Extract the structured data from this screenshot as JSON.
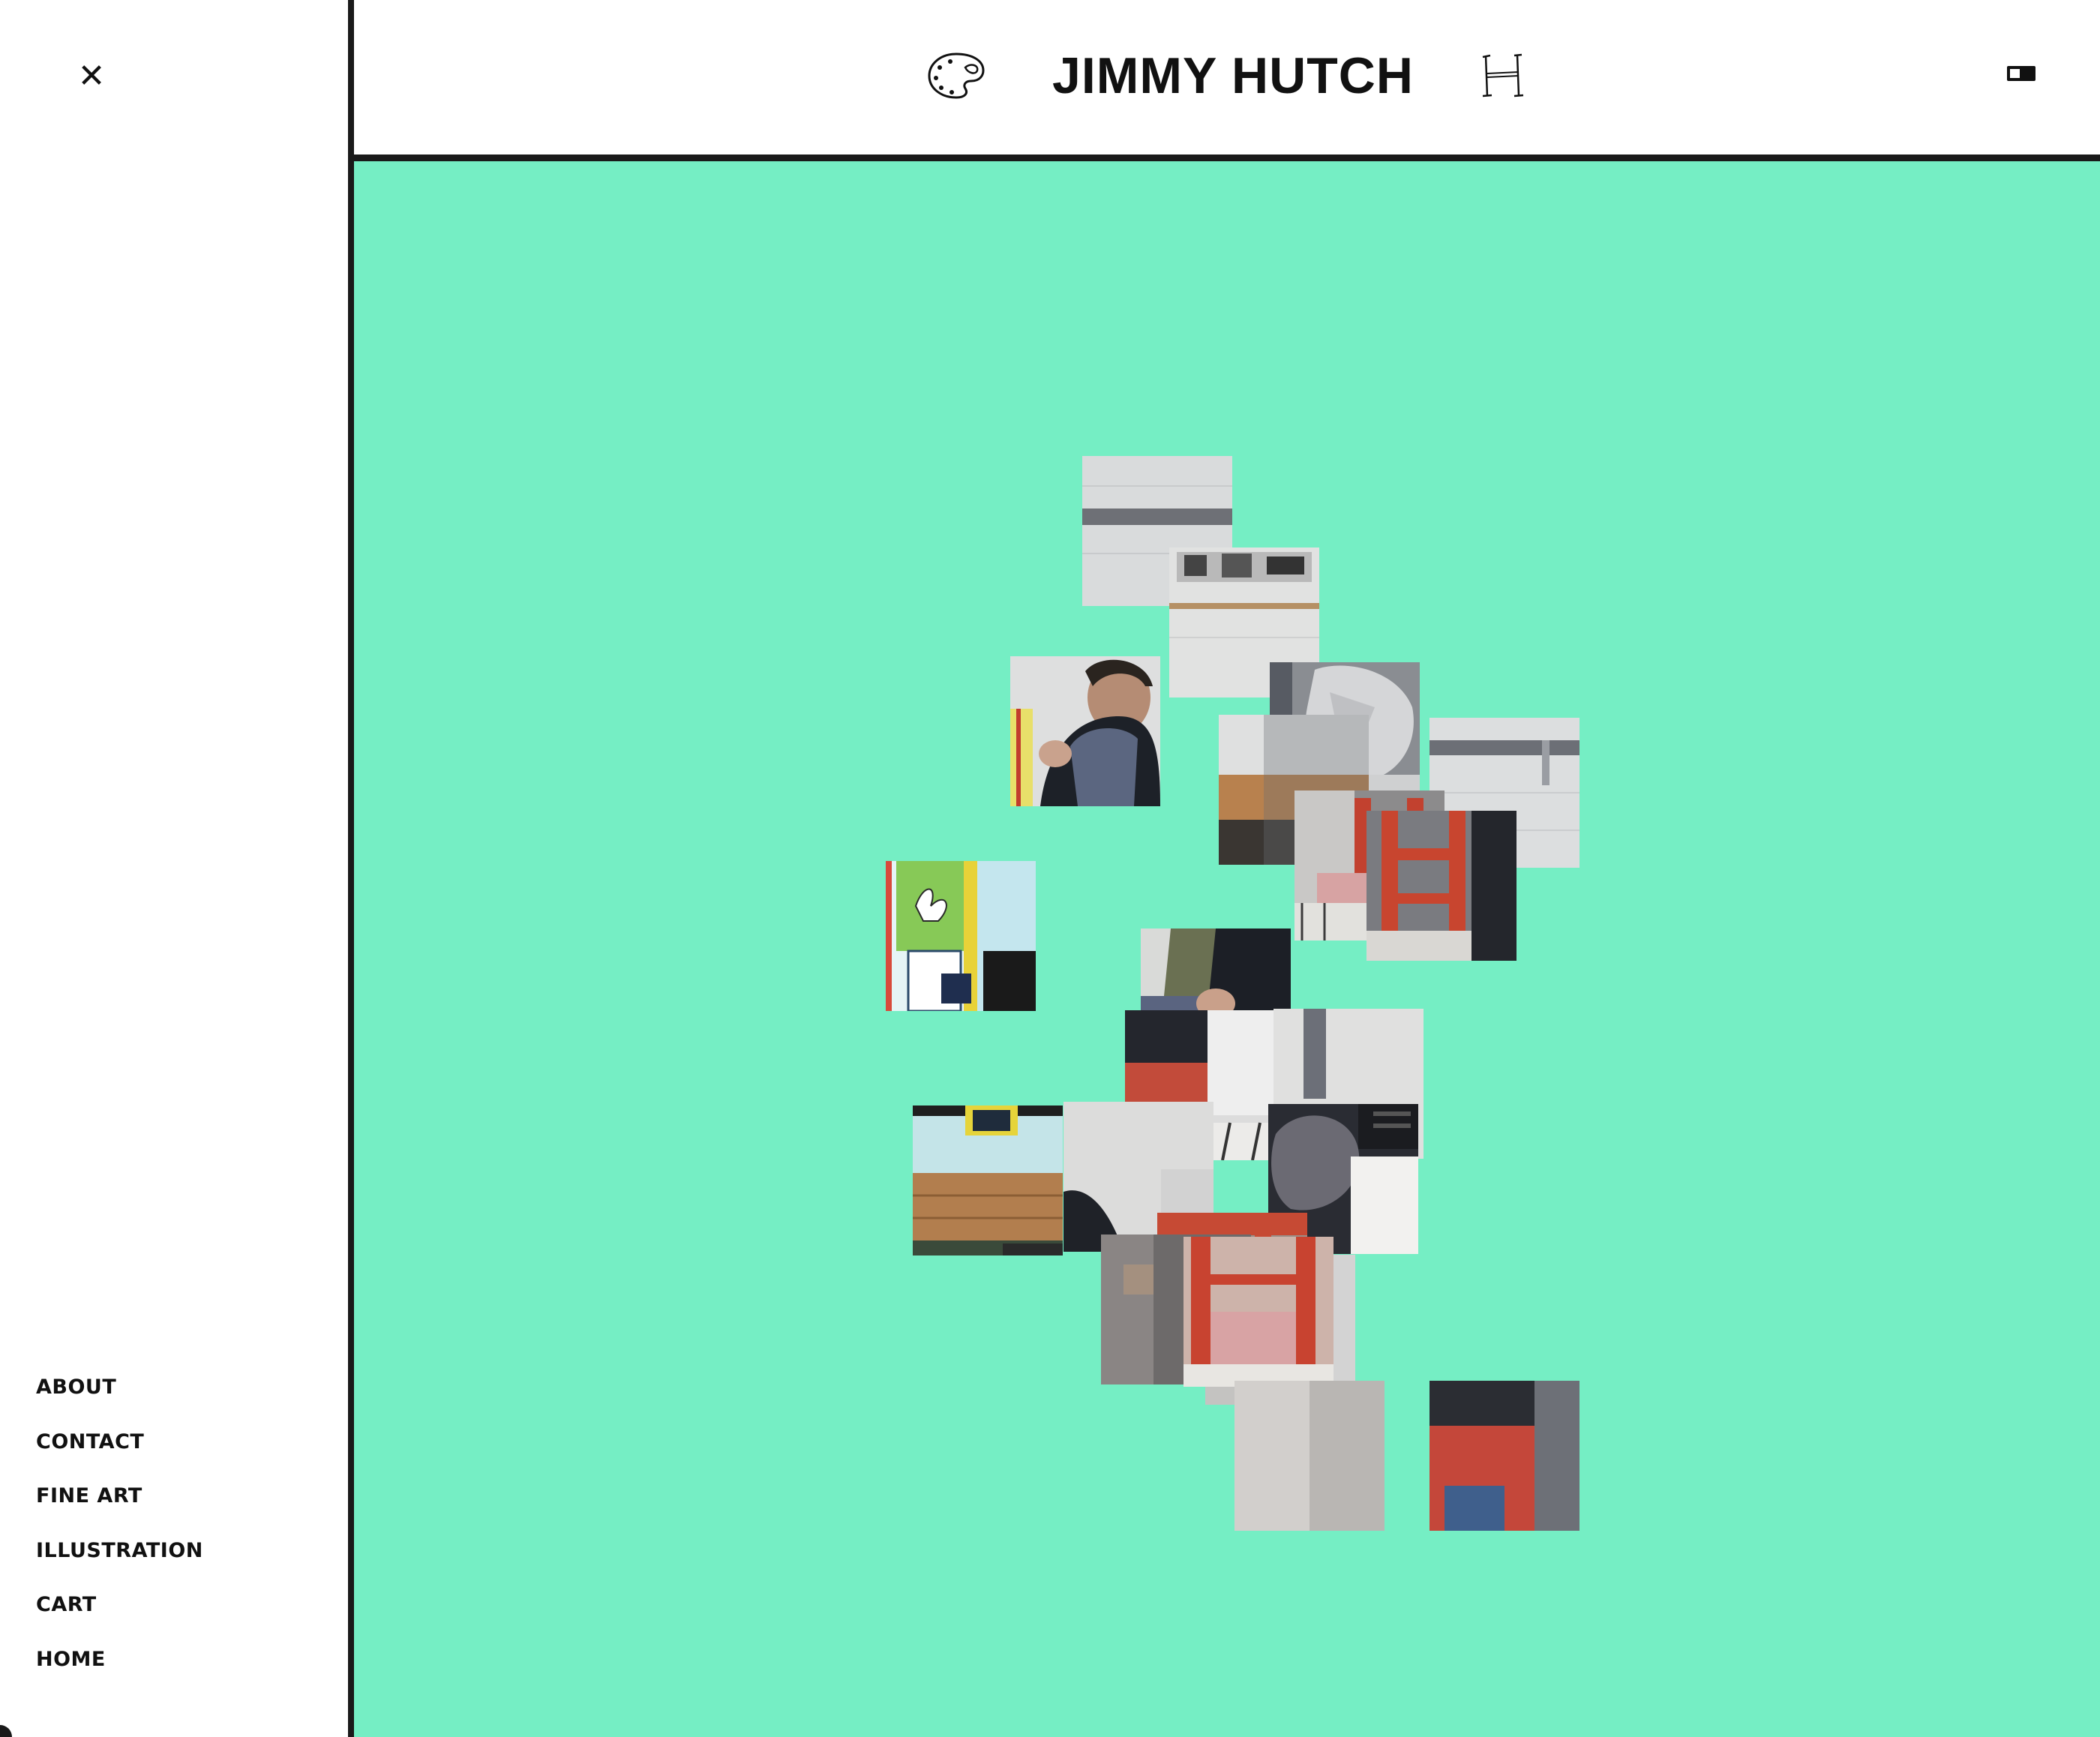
{
  "sidebar": {
    "close_icon": "close-icon",
    "nav": [
      {
        "label": "ABOUT"
      },
      {
        "label": "CONTACT"
      },
      {
        "label": "FINE ART"
      },
      {
        "label": "ILLUSTRATION"
      },
      {
        "label": "CART"
      },
      {
        "label": "HOME"
      }
    ]
  },
  "header": {
    "title": "JIMMY HUTCH",
    "left_icon": "palette-icon",
    "right_icon": "h-monogram-icon",
    "toggle_icon": "theme-toggle-icon"
  },
  "colors": {
    "main_background": "#75eec4",
    "border": "#1a1a1a",
    "text": "#111111"
  },
  "collage": {
    "description_icons": "photo-tiles",
    "tile_count": 18
  }
}
